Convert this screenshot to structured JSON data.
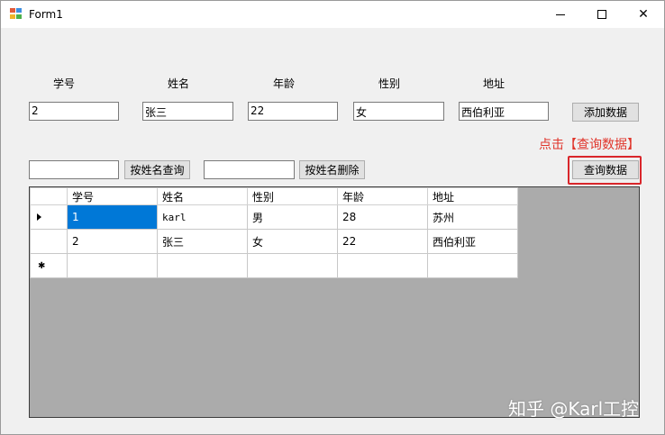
{
  "window": {
    "title": "Form1"
  },
  "labels": {
    "id": "学号",
    "name": "姓名",
    "age": "年龄",
    "gender": "性别",
    "address": "地址"
  },
  "inputs": {
    "id": "2",
    "name": "张三",
    "age": "22",
    "gender": "女",
    "address": "西伯利亚",
    "search_name": "",
    "delete_name": ""
  },
  "buttons": {
    "add": "添加数据",
    "search_by_name": "按姓名查询",
    "delete_by_name": "按姓名删除",
    "query": "查询数据"
  },
  "annotation": {
    "hint": "点击【查询数据】",
    "color": "#e0352b"
  },
  "grid": {
    "columns": [
      "学号",
      "姓名",
      "性别",
      "年龄",
      "地址"
    ],
    "rows": [
      [
        "1",
        "karl",
        "男",
        "28",
        "苏州"
      ],
      [
        "2",
        "张三",
        "女",
        "22",
        "西伯利亚"
      ]
    ],
    "selection_color": "#0078d7"
  },
  "watermark": "知乎 @Karl工控"
}
